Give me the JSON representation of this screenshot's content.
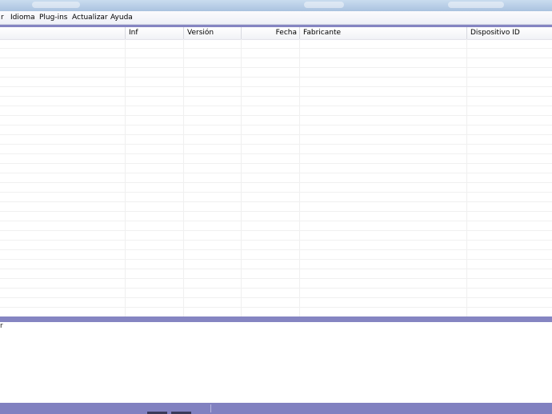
{
  "menu": {
    "items": [
      {
        "label": "r"
      },
      {
        "label": "Idioma"
      },
      {
        "label": "Plug-ins"
      },
      {
        "label": "Actualizar"
      },
      {
        "label": "Ayuda"
      }
    ]
  },
  "device_list": {
    "columns": [
      {
        "label": "Inf"
      },
      {
        "label": "Versión"
      },
      {
        "label": "Fecha"
      },
      {
        "label": "Fabricante"
      },
      {
        "label": "Dispositivo ID"
      }
    ],
    "rows": []
  },
  "log": {
    "text": "r"
  },
  "colors": {
    "accent": "#8585c2",
    "statusbar": "#8181c0",
    "titlebar": "#b7cde6"
  }
}
